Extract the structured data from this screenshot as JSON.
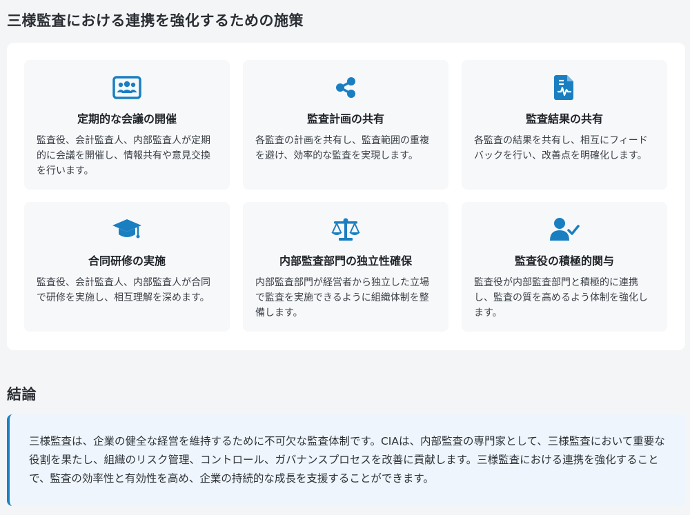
{
  "section_title": "三様監査における連携を強化するための施策",
  "accent_color": "#1a7fc1",
  "cards": [
    {
      "icon": "users-rectangle-icon",
      "title": "定期的な会議の開催",
      "desc": "監査役、会計監査人、内部監査人が定期的に会議を開催し、情報共有や意見交換を行います。"
    },
    {
      "icon": "share-nodes-icon",
      "title": "監査計画の共有",
      "desc": "各監査の計画を共有し、監査範囲の重複を避け、効率的な監査を実現します。"
    },
    {
      "icon": "file-medical-icon",
      "title": "監査結果の共有",
      "desc": "各監査の結果を共有し、相互にフィードバックを行い、改善点を明確化します。"
    },
    {
      "icon": "graduation-cap-icon",
      "title": "合同研修の実施",
      "desc": "監査役、会計監査人、内部監査人が合同で研修を実施し、相互理解を深めます。"
    },
    {
      "icon": "scale-balanced-icon",
      "title": "内部監査部門の独立性確保",
      "desc": "内部監査部門が経営者から独立した立場で監査を実施できるように組織体制を整備します。"
    },
    {
      "icon": "user-check-icon",
      "title": "監査役の積極的関与",
      "desc": "監査役が内部監査部門と積極的に連携し、監査の質を高めるよう体制を強化します。"
    }
  ],
  "conclusion": {
    "title": "結論",
    "text": "三様監査は、企業の健全な経営を維持するために不可欠な監査体制です。CIAは、内部監査の専門家として、三様監査において重要な役割を果たし、組織のリスク管理、コントロール、ガバナンスプロセスを改善に貢献します。三様監査における連携を強化することで、監査の効率性と有効性を高め、企業の持続的な成長を支援することができます。"
  }
}
